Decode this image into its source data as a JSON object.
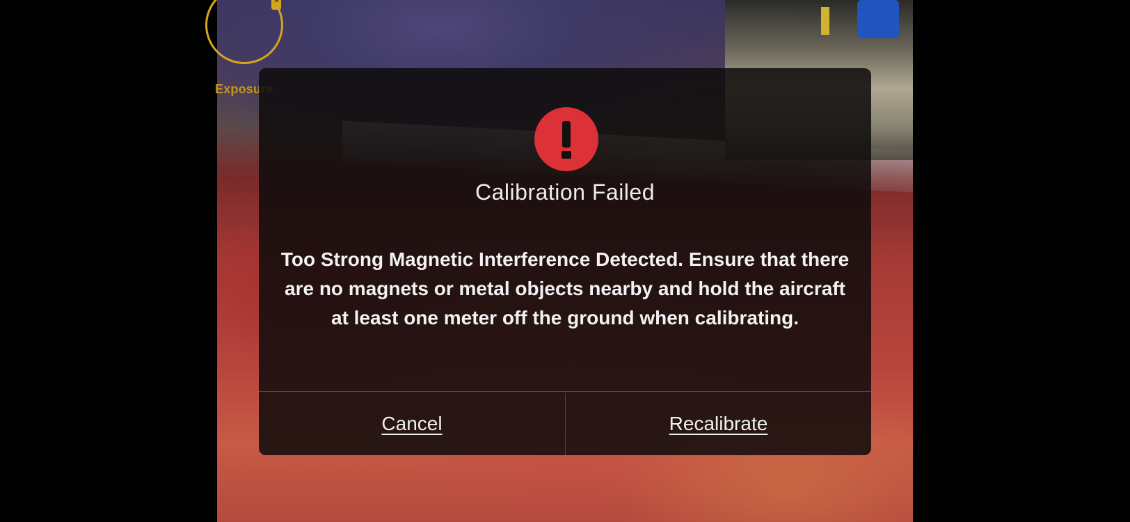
{
  "exposure": {
    "label": "Exposure"
  },
  "dialog": {
    "icon": "alert-exclamation-icon",
    "title": "Calibration Failed",
    "message": "Too Strong Magnetic Interference Detected. Ensure that there are no magnets or metal objects nearby and hold the aircraft at least one meter off the ground when calibrating.",
    "buttons": {
      "cancel": "Cancel",
      "recalibrate": "Recalibrate"
    }
  },
  "colors": {
    "alert_red": "#dc3136",
    "exposure_accent": "#d7a51d"
  }
}
